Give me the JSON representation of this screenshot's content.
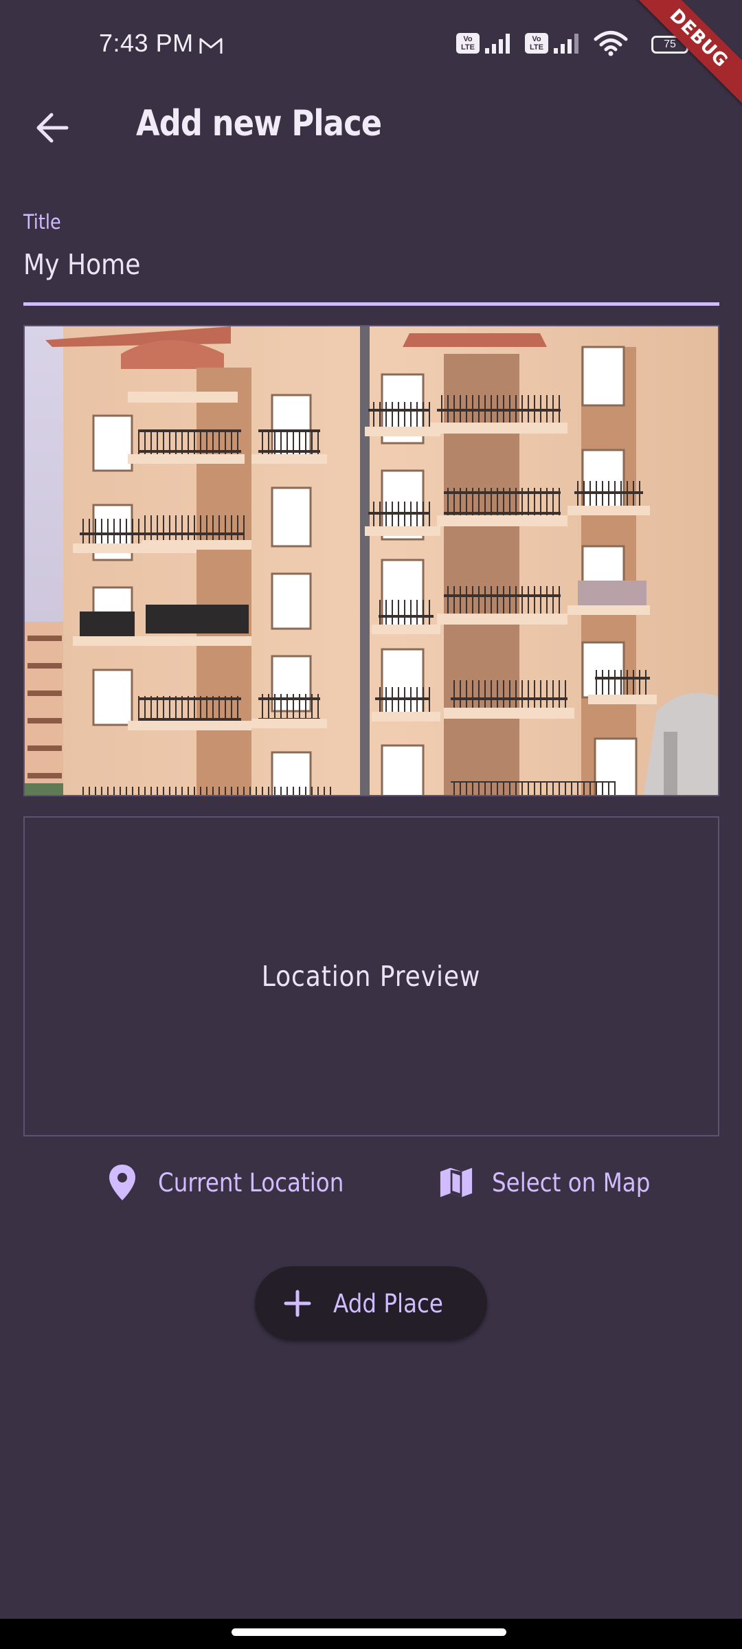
{
  "status_bar": {
    "time": "7:43 PM",
    "battery": "75",
    "volte_label": "Vo LTE",
    "debug_banner": "DEBUG"
  },
  "app_bar": {
    "title": "Add new Place",
    "back_icon": "arrow-back-icon"
  },
  "form": {
    "title_label": "Title",
    "title_value": "My Home"
  },
  "image_preview": {
    "icon": "building-photo"
  },
  "location": {
    "preview_text": "Location Preview",
    "current_location_label": "Current Location",
    "current_location_icon": "location-pin-icon",
    "select_on_map_label": "Select on Map",
    "select_on_map_icon": "map-icon"
  },
  "actions": {
    "add_place_label": "Add Place",
    "add_icon": "plus-icon"
  },
  "colors": {
    "background": "#3a3145",
    "accent": "#d1bcff",
    "button_bg": "#231e28",
    "text": "#ece4f3",
    "debug": "#a5282c"
  }
}
